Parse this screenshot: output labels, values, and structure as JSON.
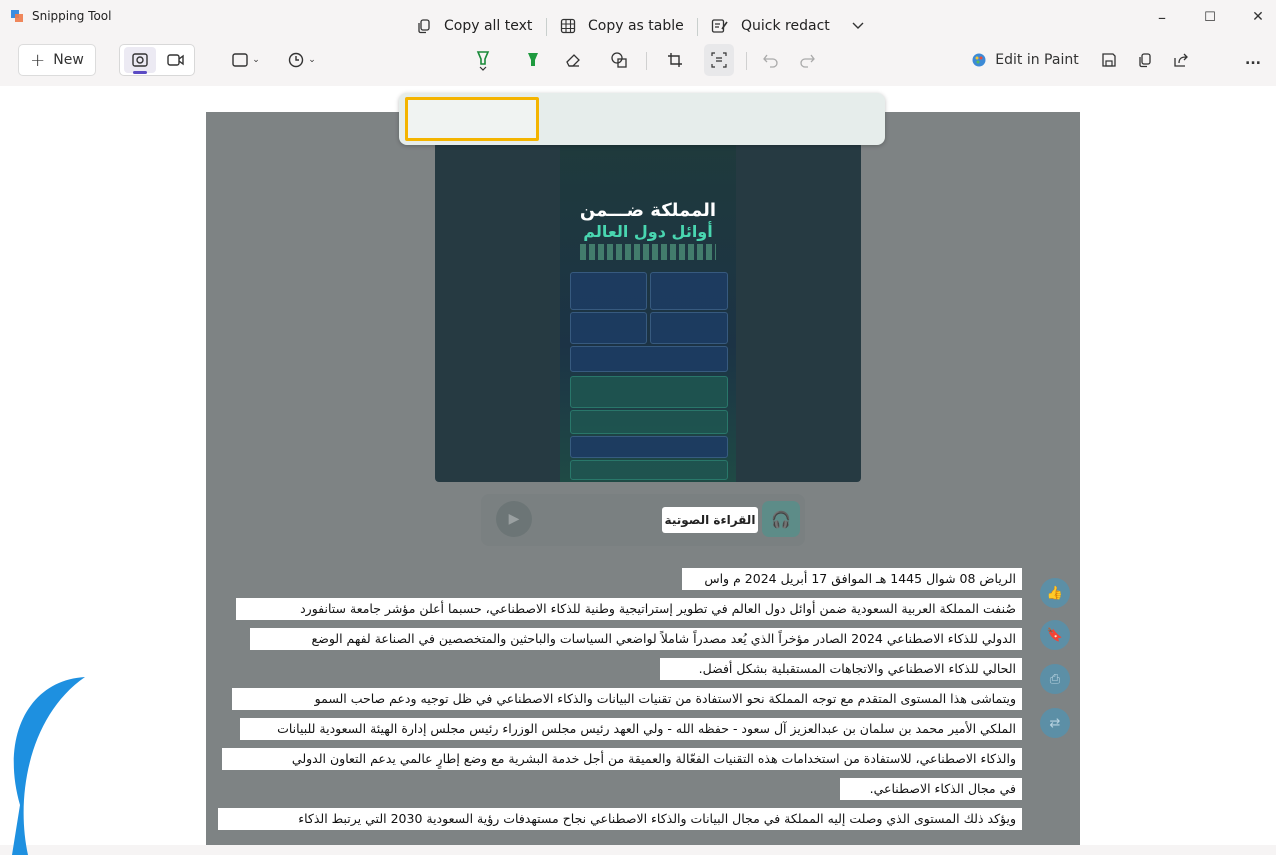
{
  "window": {
    "title": "Snipping Tool",
    "controls": {
      "minimize": "–",
      "maximize": "☐",
      "close": "✕"
    }
  },
  "toolbar": {
    "new_label": "New",
    "edit_in_paint_label": "Edit in Paint",
    "more_label": "..."
  },
  "text_actions": {
    "copy_all_text": "Copy all text",
    "copy_as_table": "Copy as table",
    "quick_redact": "Quick redact"
  },
  "poster": {
    "title_line1": "المملكة ضـــمن",
    "title_line2": "أوائل دول العالم"
  },
  "audio": {
    "label": "القراءة الصوتية"
  },
  "article": {
    "lines": [
      "الرياض 08 شوال 1445 هـ الموافق 17 أبريل 2024 م واس",
      "صُنفت المملكة العربية السعودية ضمن أوائل دول العالم في تطوير إستراتيجية وطنية للذكاء الاصطناعي، حسبما أعلن مؤشر جامعة ستانفورد",
      "الدولي للذكاء الاصطناعي 2024 الصادر مؤخراً الذي يُعد مصدراً شاملاً لواضعي السياسات والباحثين والمتخصصين في الصناعة لفهم الوضع",
      "الحالي للذكاء الاصطناعي والاتجاهات المستقبلية بشكل أفضل.",
      "ويتماشى هذا المستوى المتقدم مع توجه المملكة نحو الاستفادة من تقنيات البيانات والذكاء الاصطناعي في ظل توجيه ودعم صاحب السمو",
      "الملكي الأمير محمد بن سلمان بن عبدالعزيز آل سعود - حفظه الله - ولي العهد رئيس مجلس الوزراء رئيس مجلس إدارة الهيئة السعودية للبيانات",
      "والذكاء الاصطناعي، للاستفادة من استخدامات هذه التقنيات الفعّالة والعميقة من أجل خدمة البشرية مع وضع إطارٍ عالمي يدعم التعاون الدولي",
      "في مجال الذكاء الاصطناعي.",
      "ويؤكد ذلك المستوى الذي وصلت إليه المملكة في مجال البيانات والذكاء الاصطناعي نجاح مستهدفات رؤية السعودية 2030 التي يرتبط الذكاء"
    ]
  },
  "colors": {
    "highlight": "#f4b400",
    "accent": "#5b4bc4",
    "panel": "#7e8384"
  },
  "icons": [
    "snipping-tool-icon",
    "screenshot-mode-icon",
    "video-mode-icon",
    "shape-icon",
    "timer-icon",
    "ballpoint-pen-icon",
    "highlighter-icon",
    "eraser-icon",
    "shapes-icon",
    "crop-icon",
    "text-actions-icon",
    "undo-icon",
    "redo-icon",
    "paint-icon",
    "save-icon",
    "copy-icon",
    "share-icon"
  ]
}
